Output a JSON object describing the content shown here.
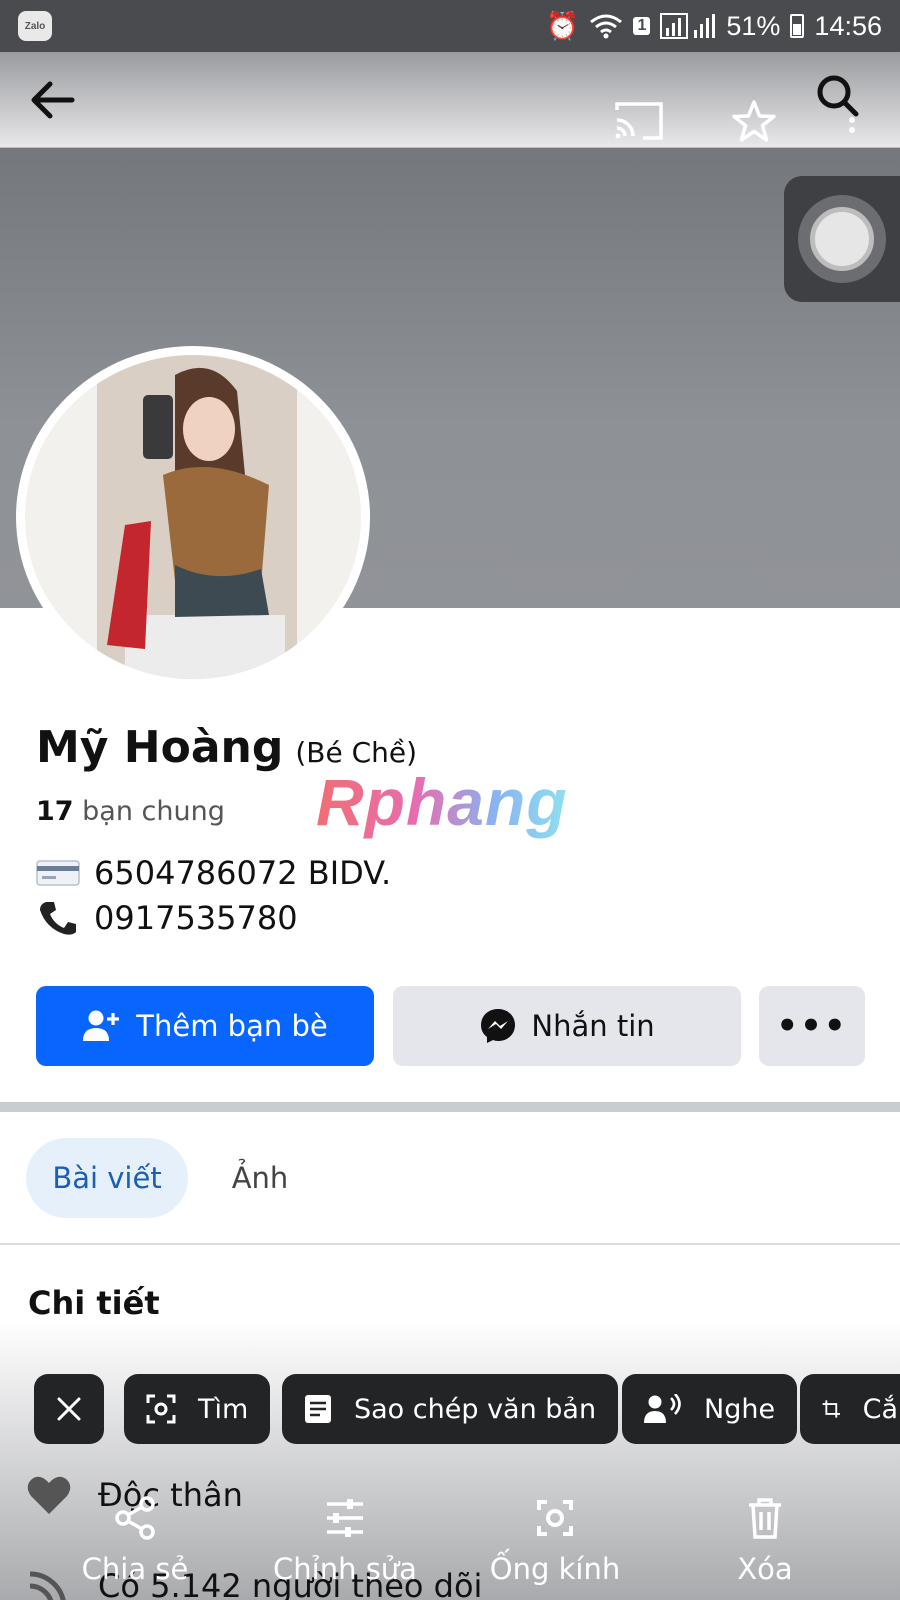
{
  "status_bar": {
    "battery": "51%",
    "time": "14:56",
    "sim_slot": "1",
    "app_badge": "Zalo"
  },
  "profile": {
    "name": "Mỹ Hoàng",
    "nickname": "(Bé Chề)",
    "mutual_count": "17",
    "mutual_label": "bạn chung",
    "bank_info": "6504786072 BIDV.",
    "phone": "0917535780"
  },
  "watermark": "Rphang",
  "buttons": {
    "add_friend": "Thêm bạn bè",
    "message": "Nhắn tin",
    "more": "•••"
  },
  "tabs": {
    "posts": "Bài viết",
    "photos": "Ảnh"
  },
  "details": {
    "title": "Chi tiết",
    "relationship": "Độc thân",
    "followers": "Có 5.142 người theo dõi"
  },
  "lens_chips": {
    "search": "Tìm",
    "copy_text": "Sao chép văn bản",
    "listen": "Nghe",
    "crop": "Cắ"
  },
  "share_actions": {
    "share": "Chia sẻ",
    "edit": "Chỉnh sửa",
    "lens": "Ống kính",
    "delete": "Xóa"
  },
  "colors": {
    "primary": "#0866ff",
    "cover": "#8e9196",
    "status_bar": "#4a4b4e",
    "chip": "#232426"
  }
}
